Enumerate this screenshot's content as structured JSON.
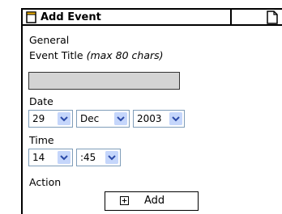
{
  "header": {
    "title": "Add Event"
  },
  "form": {
    "section_general": "General",
    "event_title_label": "Event Title",
    "event_title_hint": "(max 80 chars)",
    "event_title_value": "",
    "date_label": "Date",
    "date": {
      "day": "29",
      "month": "Dec",
      "year": "2003"
    },
    "time_label": "Time",
    "time": {
      "hour": "14",
      "minute": ":45"
    },
    "action_label": "Action",
    "add_button": "Add"
  },
  "colors": {
    "dropdown_arrow_bg": "#c5d6fb",
    "input_bg": "#d4d4d4",
    "select_border": "#7f9db9"
  },
  "icons": [
    "document-icon",
    "page-icon",
    "chevron-down-icon",
    "plus-icon"
  ]
}
